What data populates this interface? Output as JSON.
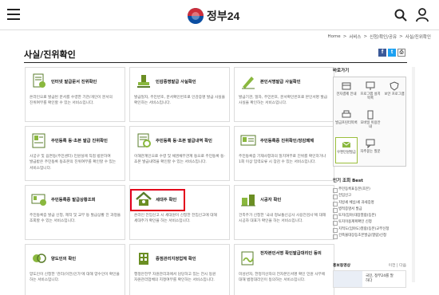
{
  "header": {
    "logo_text": "정부24",
    "brand_colors": {
      "red": "#cd2e3a",
      "blue": "#0b4ea2"
    }
  },
  "breadcrumb": [
    "Home",
    ">",
    "서비스",
    ">",
    "신청/확인/공유",
    ">",
    "사실/진위확인"
  ],
  "page": {
    "title": "사실/진위확인"
  },
  "share": {
    "facebook": "f",
    "twitter": "t"
  },
  "cards": [
    {
      "title": "인터넷 발급문서 진위확인",
      "desc": "온라인으로 발급된 문서를 수령한 기관/개인이 문서의 진위여부를 확인할 수 있는 서비스입니다.",
      "icon": "document-check-icon"
    },
    {
      "title": "인감증명발급 사실확인",
      "desc": "발급일자, 주민번호, 문서확인번호로 인감증명 발급 사실을 확인하는 서비스입니다.",
      "icon": "seal-stamp-icon"
    },
    {
      "title": "본인서명발급 사실확인",
      "desc": "발급기관, 일자, 주민번호, 문서확인번호로 본인서명 발급 사실을 확인하는 서비스입니다.",
      "icon": "pen-sign-icon"
    },
    {
      "title": "주민등록 등·초본 발급 진위확인",
      "desc": "사궁구 및 읍면동(주민센터) 민원실에 직접 방문하여 발급받은 주민등록 등초본의 진위여부를 확인할 수 있는 서비스입니다.",
      "icon": "resident-register-icon"
    },
    {
      "title": "주민등록 등·초본 발급내역 확인",
      "desc": "이해관계인으로 수령 및 채권채무관계 등으로 주민등록 등·초본 발급내역을 확인할 수 있는 서비스입니다.",
      "icon": "register-history-icon"
    },
    {
      "title": "주민등록증 진위확인/장감패제",
      "desc": "주민등록증 기재사항과의 일치여부로 진위를 확인하거나 1회 이상 입력오류 시 장감 수 있는 서비스입니다.",
      "icon": "id-card-icon"
    },
    {
      "title": "주민등록증 발급상황조회",
      "desc": "주민등록증 발급 신청, 제작 및 교부 등 발급상황 진 과정을 조회할 수 있는 서비스입니다.",
      "icon": "id-status-icon"
    },
    {
      "title": "세대주 확인",
      "desc": "온라인 전입신고 시 세대원이 신청한 전입신고에 대해 세대주가 확인을 하는 서비스입니다.",
      "icon": "household-icon"
    },
    {
      "title": "시공자 확인",
      "desc": "건축주가 신청한 '국내 정보통신공사 사용전검사'에 대해 시공자 대표가 확인을 하는 서비스입니다.",
      "icon": "constructor-icon"
    },
    {
      "title": "양도인의 확인",
      "desc": "양도인이 신청한 '관리(이전)인가'에 대해 양수인이 확인을 하는 서비스입니다.",
      "icon": "transfer-icon"
    },
    {
      "title": "중점관리지정업체 확인",
      "desc": "행정안전부 자원관리과에서 담당하고 있는 전시 동원 자원관리업체의 지정여부를 확인하는 서비스입니다.",
      "icon": "building-icon"
    },
    {
      "title": "전자본인서명 확인발급대리인 등의",
      "desc": "미성년자, 한정치산자의 전자본인서명 확인 민원 사무에 대해 법정대리인이 동의하는 서비스입니다.",
      "icon": "e-sign-icon"
    }
  ],
  "quick": {
    "heading": "바로가기",
    "items": [
      {
        "label": "전자결제 안내",
        "icon": "payment-icon",
        "active": false
      },
      {
        "label": "프로그램 설치 목록",
        "icon": "install-icon",
        "active": false
      },
      {
        "label": "보안 프로그램",
        "icon": "security-icon",
        "active": false
      },
      {
        "label": "발급프린터목록",
        "icon": "printer-icon",
        "active": false
      },
      {
        "label": "모바일 이용안내",
        "icon": "mobile-icon",
        "active": false
      },
      {
        "label": "",
        "icon": "",
        "active": false
      },
      {
        "label": "우편민원발급",
        "icon": "mail-icon",
        "active": true
      },
      {
        "label": "자주묻는 질문",
        "icon": "faq-icon",
        "active": false
      },
      {
        "label": "",
        "icon": "",
        "active": false
      }
    ]
  },
  "popular": {
    "heading": "인기 조회 Best",
    "items": [
      "주민등록표등본(초본)",
      "전입신고",
      "지방세 체납/세 과세증명",
      "병적증명서 발급",
      "토지(임야)대장열람(등본)",
      "토지이용계획확인 신청",
      "지적도(임야도)열람(등본)교부신청",
      "건축물대장등초본발급(열람)신청"
    ]
  },
  "promo": {
    "heading": "홍보동영상",
    "controls": "이전 | 다음",
    "text_line1": "국민, 정부24를 말",
    "text_line2": "하다"
  }
}
